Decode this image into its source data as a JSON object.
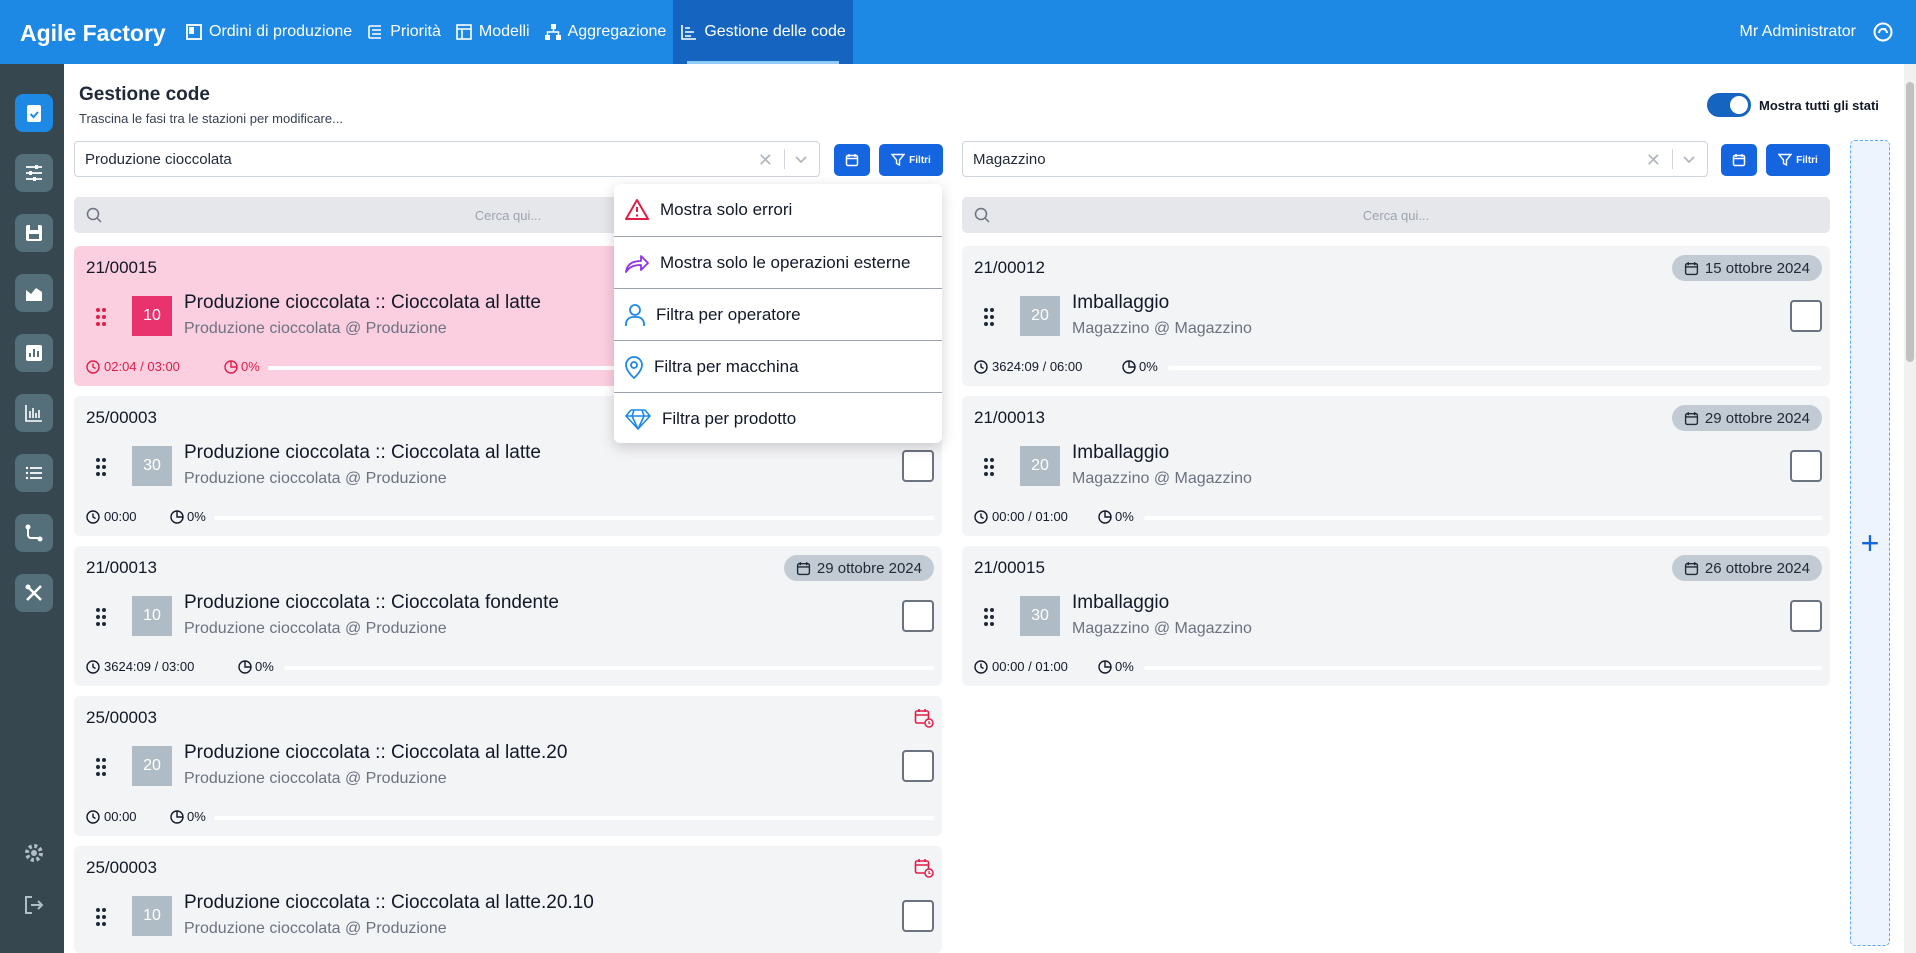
{
  "app": {
    "title": "Agile Factory",
    "user": "Mr Administrator"
  },
  "nav": [
    {
      "label": "Ordini di produzione",
      "icon": "book-icon"
    },
    {
      "label": "Priorità",
      "icon": "priority-list-icon"
    },
    {
      "label": "Modelli",
      "icon": "layout-template-icon"
    },
    {
      "label": "Aggregazione",
      "icon": "hierarchy-icon"
    },
    {
      "label": "Gestione delle code",
      "icon": "queue-icon",
      "active": true
    }
  ],
  "sidebar": [
    {
      "icon": "clipboard-check-icon",
      "active": true
    },
    {
      "icon": "sliders-icon"
    },
    {
      "icon": "save-icon"
    },
    {
      "icon": "area-chart-icon"
    },
    {
      "icon": "bar-chart-icon"
    },
    {
      "icon": "line-chart-icon"
    },
    {
      "icon": "list-icon"
    },
    {
      "icon": "route-icon"
    },
    {
      "icon": "tools-icon"
    },
    {
      "icon": "gear-icon"
    },
    {
      "icon": "logout-icon"
    }
  ],
  "page": {
    "title": "Gestione code",
    "subtitle": "Trascina le fasi tra le stazioni per modificare...",
    "toggle_label": "Mostra tutti gli stati",
    "toggle_on": true
  },
  "left": {
    "station": "Produzione cioccolata",
    "filters_label": "Filtri",
    "search_placeholder": "Cerca qui...",
    "cards": [
      {
        "code": "21/00015",
        "num": "10",
        "title": "Produzione cioccolata :: Cioccolata al latte",
        "subtitle": "Produzione cioccolata @ Produzione",
        "time": "02:04 / 03:00",
        "pct": "0%",
        "error": true
      },
      {
        "code": "25/00003",
        "num": "30",
        "title": "Produzione cioccolata :: Cioccolata al latte",
        "subtitle": "Produzione cioccolata @ Produzione",
        "time": "00:00",
        "pct": "0%"
      },
      {
        "code": "21/00013",
        "num": "10",
        "title": "Produzione cioccolata :: Cioccolata fondente",
        "subtitle": "Produzione cioccolata @ Produzione",
        "time": "3624:09 / 03:00",
        "pct": "0%",
        "date": "29 ottobre 2024"
      },
      {
        "code": "25/00003",
        "num": "20",
        "title": "Produzione cioccolata :: Cioccolata al latte.20",
        "subtitle": "Produzione cioccolata @ Produzione",
        "time": "00:00",
        "pct": "0%",
        "warn": true
      },
      {
        "code": "25/00003",
        "num": "10",
        "title": "Produzione cioccolata :: Cioccolata al latte.20.10",
        "subtitle": "Produzione cioccolata @ Produzione",
        "warn": true
      }
    ]
  },
  "right": {
    "station": "Magazzino",
    "filters_label": "Filtri",
    "search_placeholder": "Cerca qui...",
    "cards": [
      {
        "code": "21/00012",
        "num": "20",
        "title": "Imballaggio",
        "subtitle": "Magazzino @ Magazzino",
        "time": "3624:09 / 06:00",
        "pct": "0%",
        "date": "15 ottobre 2024"
      },
      {
        "code": "21/00013",
        "num": "20",
        "title": "Imballaggio",
        "subtitle": "Magazzino @ Magazzino",
        "time": "00:00 / 01:00",
        "pct": "0%",
        "date": "29 ottobre 2024"
      },
      {
        "code": "21/00015",
        "num": "30",
        "title": "Imballaggio",
        "subtitle": "Magazzino @ Magazzino",
        "time": "00:00 / 01:00",
        "pct": "0%",
        "date": "26 ottobre 2024"
      }
    ]
  },
  "filter_menu": [
    {
      "label": "Mostra solo errori",
      "icon": "warning-icon"
    },
    {
      "label": "Mostra solo le operazioni esterne",
      "icon": "share-arrow-icon"
    },
    {
      "label": "Filtra per operatore",
      "icon": "user-icon"
    },
    {
      "label": "Filtra per macchina",
      "icon": "map-pin-icon"
    },
    {
      "label": "Filtra per prodotto",
      "icon": "diamond-icon"
    }
  ],
  "colors": {
    "primary": "#1e88e5",
    "button": "#1565e0",
    "error_card": "#fbcfe0",
    "error_text": "#e11d48",
    "sidebar": "#37474f"
  }
}
